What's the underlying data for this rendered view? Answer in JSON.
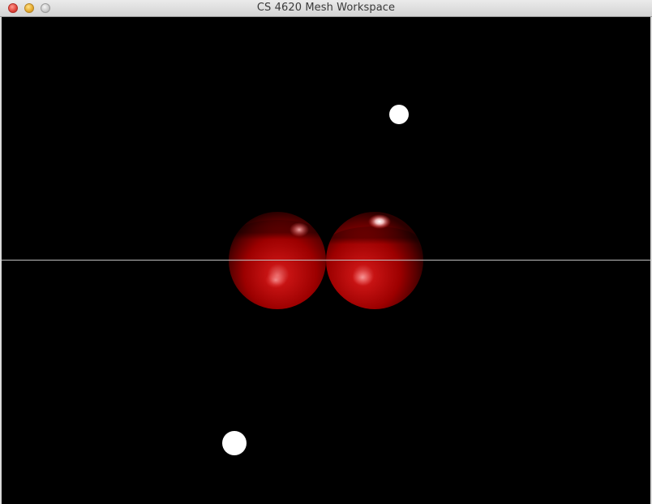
{
  "window": {
    "title": "CS 4620 Mesh Workspace"
  },
  "colors": {
    "background": "#000000",
    "sphere": "#cc0000",
    "light_marker": "#ffffff",
    "axis_line": "#bfbfbf"
  },
  "scene": {
    "objects": [
      {
        "kind": "sphere",
        "name": "left-sphere"
      },
      {
        "kind": "sphere",
        "name": "right-sphere"
      },
      {
        "kind": "light",
        "name": "upper-light"
      },
      {
        "kind": "light",
        "name": "lower-light"
      }
    ]
  }
}
